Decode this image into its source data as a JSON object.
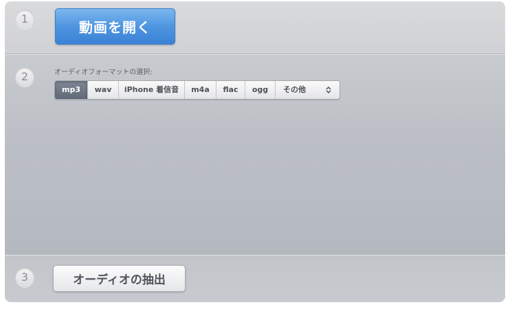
{
  "steps": {
    "step1": {
      "number": "1",
      "open_button_label": "動画を開く"
    },
    "step2": {
      "number": "2",
      "format_label": "オーディオフォーマットの選択:",
      "formats": [
        "mp3",
        "wav",
        "iPhone 着信音",
        "m4a",
        "flac",
        "ogg"
      ],
      "selected_format": "mp3",
      "other_select_label": "その他"
    },
    "step3": {
      "number": "3",
      "extract_button_label": "オーディオの抽出"
    }
  },
  "colors": {
    "primary_button": "#4f95e0",
    "selected_segment": "#616a78"
  },
  "icons": {
    "select_arrows": "up-down-chevron-icon"
  }
}
